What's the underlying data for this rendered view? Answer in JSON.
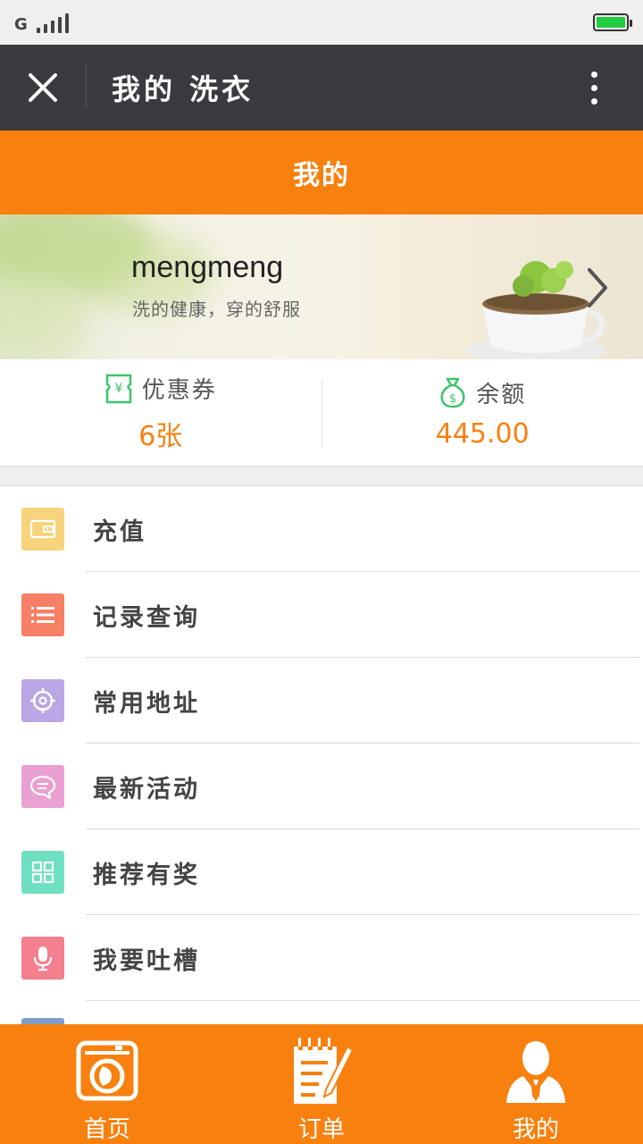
{
  "status_bar": {
    "network": "G"
  },
  "title_bar": {
    "title": "我的 洗衣"
  },
  "header": {
    "title": "我的"
  },
  "profile": {
    "name": "mengmeng",
    "slogan": "洗的健康，穿的舒服"
  },
  "stats": {
    "coupon": {
      "label": "优惠券",
      "value": "6张",
      "icon": "coupon-icon"
    },
    "balance": {
      "label": "余额",
      "value": "445.00",
      "icon": "money-bag-icon"
    }
  },
  "menu": {
    "items": [
      {
        "label": "充值",
        "icon": "wallet-icon",
        "color": "#f7d47c"
      },
      {
        "label": "记录查询",
        "icon": "list-icon",
        "color": "#f77f66"
      },
      {
        "label": "常用地址",
        "icon": "location-target-icon",
        "color": "#b9a6e4"
      },
      {
        "label": "最新活动",
        "icon": "chat-bubble-icon",
        "color": "#eaa0d1"
      },
      {
        "label": "推荐有奖",
        "icon": "grid-icon",
        "color": "#6fdfc1"
      },
      {
        "label": "我要吐槽",
        "icon": "microphone-icon",
        "color": "#f37f8f"
      }
    ]
  },
  "tabs": [
    {
      "label": "首页",
      "icon": "washing-machine-icon"
    },
    {
      "label": "订单",
      "icon": "order-notepad-icon"
    },
    {
      "label": "我的",
      "icon": "user-icon"
    }
  ],
  "colors": {
    "accent": "#f8800f",
    "title_bar": "#3a3b3f",
    "coupon_green": "#3cc56b"
  }
}
